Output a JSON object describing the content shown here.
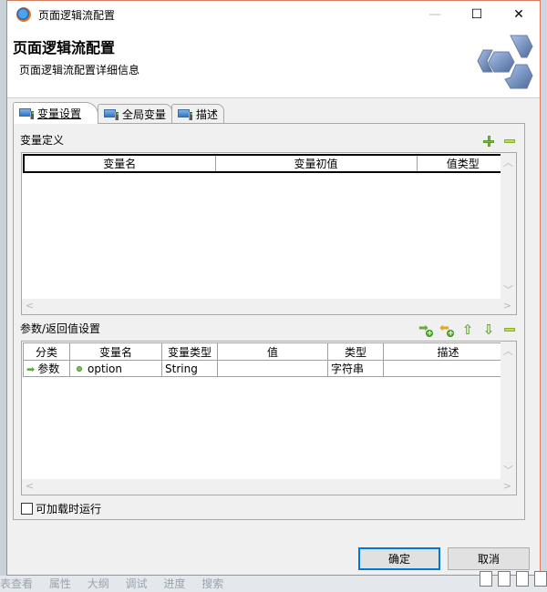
{
  "window": {
    "title": "页面逻辑流配置",
    "minimize_glyph": "—",
    "maximize_glyph": "☐",
    "close_glyph": "✕"
  },
  "header": {
    "title": "页面逻辑流配置",
    "description": "页面逻辑流配置详细信息"
  },
  "tabs": [
    {
      "label": "变量设置",
      "icon": "computer-icon",
      "active": true
    },
    {
      "label": "全局变量",
      "icon": "computer-icon",
      "active": false
    },
    {
      "label": "描述",
      "icon": "computer-icon",
      "active": false
    }
  ],
  "variables": {
    "section_label": "变量定义",
    "toolbar": {
      "add": "plus-icon",
      "remove": "minus-icon"
    },
    "columns": [
      "变量名",
      "变量初值",
      "值类型"
    ],
    "rows": []
  },
  "params": {
    "section_label": "参数/返回值设置",
    "toolbar": {
      "add_param": "add-param-icon",
      "add_return": "add-return-icon",
      "move_up": "arrow-up-icon",
      "move_down": "arrow-down-icon",
      "remove": "minus-icon"
    },
    "columns": [
      "分类",
      "变量名",
      "变量类型",
      "值",
      "类型",
      "描述"
    ],
    "rows": [
      {
        "category": "参数",
        "name": "option",
        "var_type": "String",
        "value": "",
        "type": "字符串",
        "description": ""
      }
    ]
  },
  "load_run": {
    "label": "可加载时运行",
    "checked": false
  },
  "buttons": {
    "ok": "确定",
    "cancel": "取消"
  },
  "background_taskbar": [
    "表查看",
    "属性",
    "大纲",
    "调试",
    "进度",
    "搜索"
  ],
  "colors": {
    "accent": "#0078d7",
    "window_border": "#d77c62",
    "icon_green": "#7bbd43"
  }
}
